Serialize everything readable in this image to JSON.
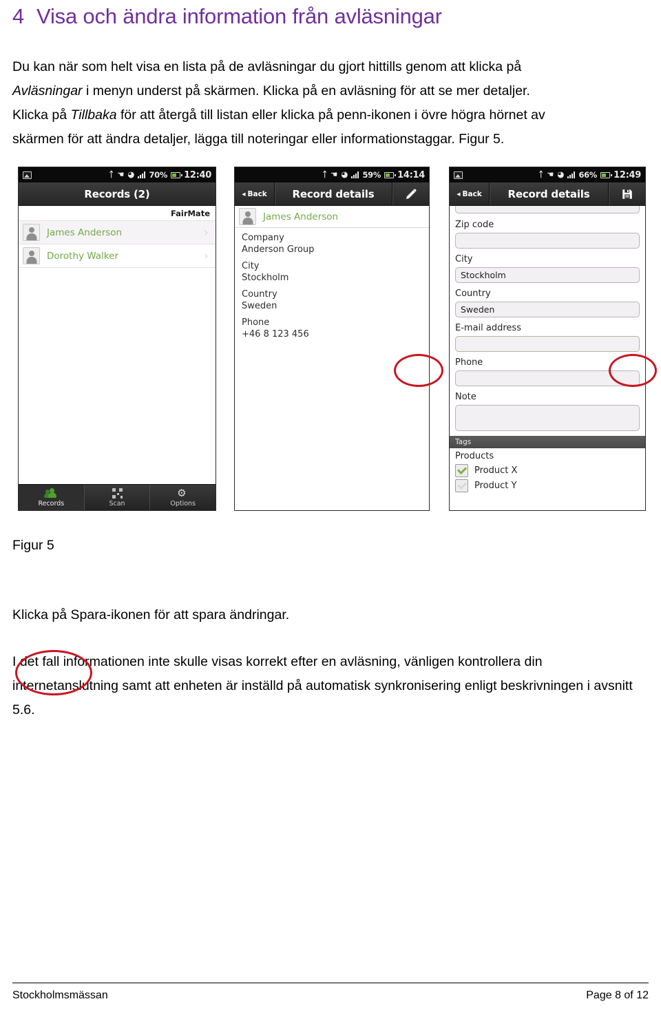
{
  "heading": {
    "number": "4",
    "text": "Visa och ändra information från avläsningar",
    "color": "#7030A0"
  },
  "paragraphs": {
    "intro_line1": "Du kan när som helt visa en lista på de avläsningar du gjort hittills genom att klicka på",
    "intro_em1": "Avläsningar",
    "intro_line2a": " i menyn underst på skärmen. Klicka på en avläsning för att se mer detaljer.",
    "intro_line3a": "Klicka på ",
    "intro_em2": "Tillbaka",
    "intro_line3b": " för att återgå till listan eller klicka på penn-ikonen i övre högra hörnet av",
    "intro_line4": "skärmen för att ändra detaljer, lägga till noteringar eller informationstaggar. Figur 5.",
    "figure_caption": "Figur 5",
    "p2": "Klicka på Spara-ikonen för att spara ändringar.",
    "p3": "I det fall informationen inte skulle visas korrekt efter en avläsning, vänligen kontrollera din internetanslutning samt att enheten är inställd på automatisk synkronisering enligt beskrivningen i avsnitt 5.6."
  },
  "figure": {
    "annotation_color": "#c81621",
    "phone1": {
      "status": {
        "battery_percent": "70%",
        "clock": "12:40",
        "gallery_icon": "gallery-icon",
        "bluetooth_icon": "bluetooth-icon",
        "vpn_icon": "vpn-icon",
        "wifi_icon": "wifi-icon",
        "signal_icon": "signal-icon",
        "battery_icon": "battery-icon"
      },
      "title": "Records (2)",
      "brand": "FairMate",
      "records": [
        {
          "name": "James Anderson"
        },
        {
          "name": "Dorothy Walker"
        }
      ],
      "tabs": [
        {
          "label": "Records",
          "icon": "people-icon",
          "active": true
        },
        {
          "label": "Scan",
          "icon": "qr-icon",
          "active": false
        },
        {
          "label": "Options",
          "icon": "gear-icon",
          "active": false
        }
      ]
    },
    "phone2": {
      "status": {
        "battery_percent": "59%",
        "clock": "14:14"
      },
      "back_label": "Back",
      "title": "Record details",
      "action_icon": "pencil-icon",
      "contact_name": "James Anderson",
      "details": [
        {
          "label": "Company",
          "value": "Anderson Group"
        },
        {
          "label": "City",
          "value": "Stockholm"
        },
        {
          "label": "Country",
          "value": "Sweden"
        },
        {
          "label": "Phone",
          "value": "+46 8 123 456"
        }
      ]
    },
    "phone3": {
      "status": {
        "battery_percent": "66%",
        "clock": "12:49"
      },
      "back_label": "Back",
      "title": "Record details",
      "action_icon": "save-icon",
      "fields": [
        {
          "label": "Zip code",
          "value": ""
        },
        {
          "label": "City",
          "value": "Stockholm"
        },
        {
          "label": "Country",
          "value": "Sweden"
        },
        {
          "label": "E-mail address",
          "value": ""
        },
        {
          "label": "Phone",
          "value": ""
        },
        {
          "label": "Note",
          "value": ""
        }
      ],
      "tags_header": "Tags",
      "products_label": "Products",
      "products": [
        {
          "label": "Product X",
          "checked": true
        },
        {
          "label": "Product Y",
          "checked": false
        }
      ]
    }
  },
  "footer": {
    "left": "Stockholmsmässan",
    "right": "Page 8 of 12"
  }
}
